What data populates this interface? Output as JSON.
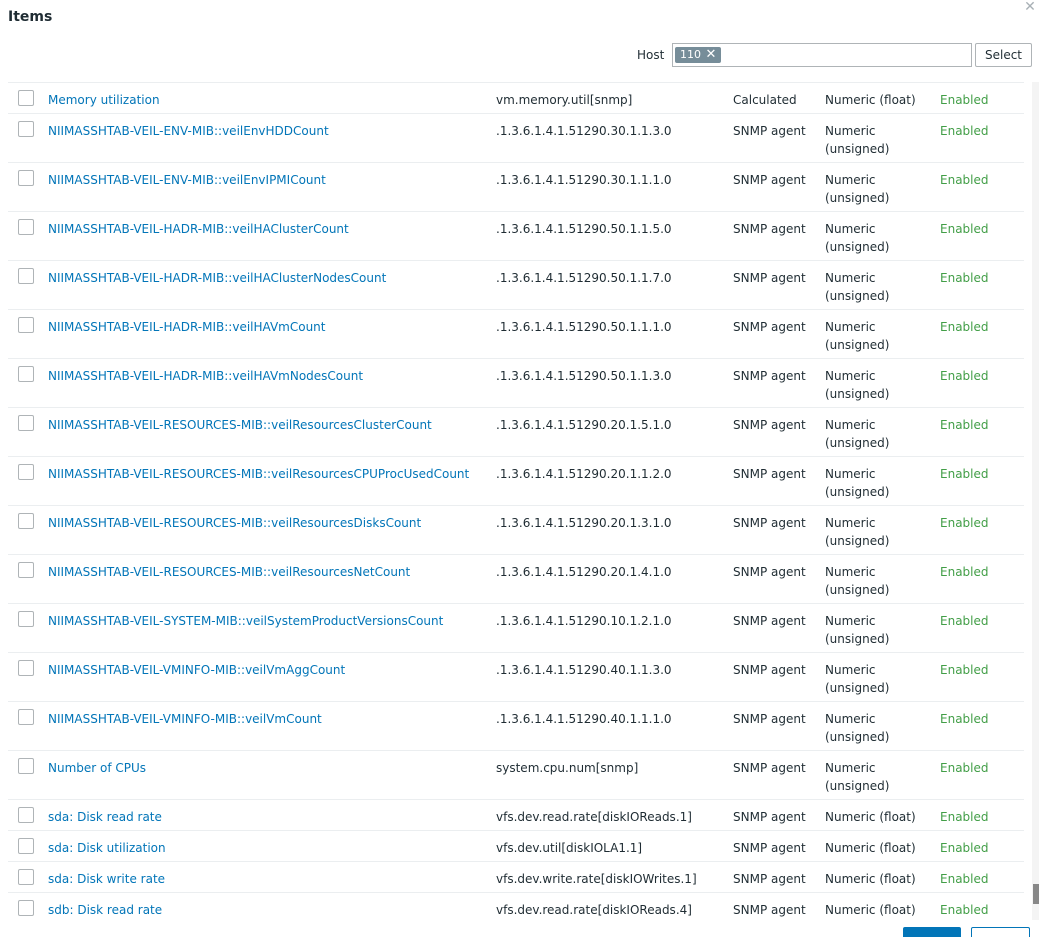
{
  "dialog": {
    "title": "Items",
    "close_icon": "close-icon"
  },
  "filter": {
    "host_label": "Host",
    "host_chip": "110",
    "chip_remove": "✕",
    "select_label": "Select"
  },
  "items": [
    {
      "name": "Memory utilization",
      "key": "vm.memory.util[snmp]",
      "type": "Calculated",
      "value_type": "Numeric (float)",
      "status": "Enabled"
    },
    {
      "name": "NIIMASSHTAB-VEIL-ENV-MIB::veilEnvHDDCount",
      "key": ".1.3.6.1.4.1.51290.30.1.1.3.0",
      "type": "SNMP agent",
      "value_type": "Numeric (unsigned)",
      "status": "Enabled"
    },
    {
      "name": "NIIMASSHTAB-VEIL-ENV-MIB::veilEnvIPMICount",
      "key": ".1.3.6.1.4.1.51290.30.1.1.1.0",
      "type": "SNMP agent",
      "value_type": "Numeric (unsigned)",
      "status": "Enabled"
    },
    {
      "name": "NIIMASSHTAB-VEIL-HADR-MIB::veilHAClusterCount",
      "key": ".1.3.6.1.4.1.51290.50.1.1.5.0",
      "type": "SNMP agent",
      "value_type": "Numeric (unsigned)",
      "status": "Enabled"
    },
    {
      "name": "NIIMASSHTAB-VEIL-HADR-MIB::veilHAClusterNodesCount",
      "key": ".1.3.6.1.4.1.51290.50.1.1.7.0",
      "type": "SNMP agent",
      "value_type": "Numeric (unsigned)",
      "status": "Enabled"
    },
    {
      "name": "NIIMASSHTAB-VEIL-HADR-MIB::veilHAVmCount",
      "key": ".1.3.6.1.4.1.51290.50.1.1.1.0",
      "type": "SNMP agent",
      "value_type": "Numeric (unsigned)",
      "status": "Enabled"
    },
    {
      "name": "NIIMASSHTAB-VEIL-HADR-MIB::veilHAVmNodesCount",
      "key": ".1.3.6.1.4.1.51290.50.1.1.3.0",
      "type": "SNMP agent",
      "value_type": "Numeric (unsigned)",
      "status": "Enabled"
    },
    {
      "name": "NIIMASSHTAB-VEIL-RESOURCES-MIB::veilResourcesClusterCount",
      "key": ".1.3.6.1.4.1.51290.20.1.5.1.0",
      "type": "SNMP agent",
      "value_type": "Numeric (unsigned)",
      "status": "Enabled"
    },
    {
      "name": "NIIMASSHTAB-VEIL-RESOURCES-MIB::veilResourcesCPUProcUsedCount",
      "key": ".1.3.6.1.4.1.51290.20.1.1.2.0",
      "type": "SNMP agent",
      "value_type": "Numeric (unsigned)",
      "status": "Enabled"
    },
    {
      "name": "NIIMASSHTAB-VEIL-RESOURCES-MIB::veilResourcesDisksCount",
      "key": ".1.3.6.1.4.1.51290.20.1.3.1.0",
      "type": "SNMP agent",
      "value_type": "Numeric (unsigned)",
      "status": "Enabled"
    },
    {
      "name": "NIIMASSHTAB-VEIL-RESOURCES-MIB::veilResourcesNetCount",
      "key": ".1.3.6.1.4.1.51290.20.1.4.1.0",
      "type": "SNMP agent",
      "value_type": "Numeric (unsigned)",
      "status": "Enabled"
    },
    {
      "name": "NIIMASSHTAB-VEIL-SYSTEM-MIB::veilSystemProductVersionsCount",
      "key": ".1.3.6.1.4.1.51290.10.1.2.1.0",
      "type": "SNMP agent",
      "value_type": "Numeric (unsigned)",
      "status": "Enabled"
    },
    {
      "name": "NIIMASSHTAB-VEIL-VMINFO-MIB::veilVmAggCount",
      "key": ".1.3.6.1.4.1.51290.40.1.1.3.0",
      "type": "SNMP agent",
      "value_type": "Numeric (unsigned)",
      "status": "Enabled"
    },
    {
      "name": "NIIMASSHTAB-VEIL-VMINFO-MIB::veilVmCount",
      "key": ".1.3.6.1.4.1.51290.40.1.1.1.0",
      "type": "SNMP agent",
      "value_type": "Numeric (unsigned)",
      "status": "Enabled"
    },
    {
      "name": "Number of CPUs",
      "key": "system.cpu.num[snmp]",
      "type": "SNMP agent",
      "value_type": "Numeric (unsigned)",
      "status": "Enabled"
    },
    {
      "name": "sda: Disk read rate",
      "key": "vfs.dev.read.rate[diskIOReads.1]",
      "type": "SNMP agent",
      "value_type": "Numeric (float)",
      "status": "Enabled"
    },
    {
      "name": "sda: Disk utilization",
      "key": "vfs.dev.util[diskIOLA1.1]",
      "type": "SNMP agent",
      "value_type": "Numeric (float)",
      "status": "Enabled"
    },
    {
      "name": "sda: Disk write rate",
      "key": "vfs.dev.write.rate[diskIOWrites.1]",
      "type": "SNMP agent",
      "value_type": "Numeric (float)",
      "status": "Enabled"
    },
    {
      "name": "sdb: Disk read rate",
      "key": "vfs.dev.read.rate[diskIOReads.4]",
      "type": "SNMP agent",
      "value_type": "Numeric (float)",
      "status": "Enabled"
    }
  ]
}
